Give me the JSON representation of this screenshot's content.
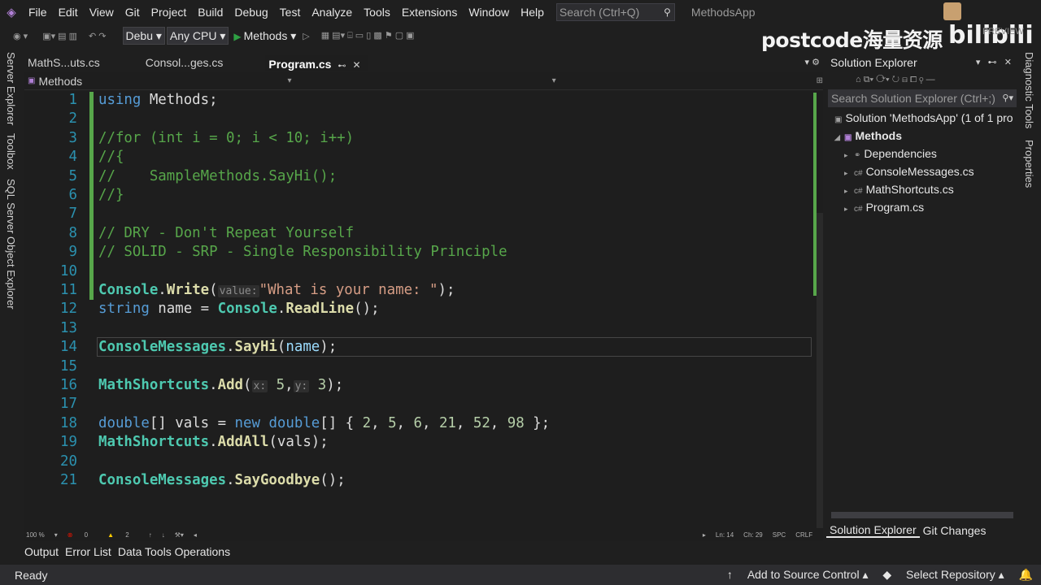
{
  "menu": {
    "items": [
      "File",
      "Edit",
      "View",
      "Git",
      "Project",
      "Build",
      "Debug",
      "Test",
      "Analyze",
      "Tools",
      "Extensions",
      "Window",
      "Help"
    ],
    "search_placeholder": "Search (Ctrl+Q)",
    "app_title": "MethodsApp"
  },
  "watermark": {
    "text": "postcode海量资源",
    "brand": "bilibili",
    "preview": "PREVIEW"
  },
  "toolbar": {
    "config": "Debu",
    "platform": "Any CPU",
    "run_label": "Methods"
  },
  "left_rail": [
    "Server Explorer",
    "Toolbox",
    "SQL Server Object Explorer"
  ],
  "right_rail": [
    "Diagnostic Tools",
    "Properties"
  ],
  "tabs": [
    {
      "label": "MathS...uts.cs"
    },
    {
      "label": "Consol...ges.cs"
    },
    {
      "label": "Program.cs",
      "active": true
    }
  ],
  "navbar": {
    "scope": "Methods"
  },
  "editor": {
    "current_line": 14,
    "lines": [
      {
        "n": "1",
        "tokens": [
          [
            "kw",
            "using"
          ],
          [
            "plain",
            " Methods;"
          ]
        ]
      },
      {
        "n": "2",
        "tokens": []
      },
      {
        "n": "3",
        "tokens": [
          [
            "cm",
            "//for (int i = 0; i < 10; i++)"
          ]
        ]
      },
      {
        "n": "4",
        "tokens": [
          [
            "cm",
            "//{"
          ]
        ]
      },
      {
        "n": "5",
        "tokens": [
          [
            "cm",
            "//    SampleMethods.SayHi();"
          ]
        ]
      },
      {
        "n": "6",
        "tokens": [
          [
            "cm",
            "//}"
          ]
        ]
      },
      {
        "n": "7",
        "tokens": []
      },
      {
        "n": "8",
        "tokens": [
          [
            "cm",
            "// DRY - Don't Repeat Yourself"
          ]
        ]
      },
      {
        "n": "9",
        "tokens": [
          [
            "cm",
            "// SOLID - SRP - Single Responsibility Principle"
          ]
        ]
      },
      {
        "n": "10",
        "tokens": []
      },
      {
        "n": "11",
        "tokens": [
          [
            "cls",
            "Console"
          ],
          [
            "plain",
            "."
          ],
          [
            "mth",
            "Write"
          ],
          [
            "plain",
            "("
          ],
          [
            "hint",
            "value:"
          ],
          [
            "str",
            "\"What is your name: \""
          ],
          [
            "plain",
            ");"
          ]
        ]
      },
      {
        "n": "12",
        "tokens": [
          [
            "kw",
            "string"
          ],
          [
            "plain",
            " name = "
          ],
          [
            "cls",
            "Console"
          ],
          [
            "plain",
            "."
          ],
          [
            "mth",
            "ReadLine"
          ],
          [
            "plain",
            "();"
          ]
        ]
      },
      {
        "n": "13",
        "tokens": []
      },
      {
        "n": "14",
        "tokens": [
          [
            "cls",
            "ConsoleMessages"
          ],
          [
            "plain",
            "."
          ],
          [
            "mth",
            "SayHi"
          ],
          [
            "plain",
            "("
          ],
          [
            "var",
            "name"
          ],
          [
            "plain",
            ");"
          ]
        ]
      },
      {
        "n": "15",
        "tokens": []
      },
      {
        "n": "16",
        "tokens": [
          [
            "cls",
            "MathShortcuts"
          ],
          [
            "plain",
            "."
          ],
          [
            "mth",
            "Add"
          ],
          [
            "plain",
            "("
          ],
          [
            "hint",
            "x:"
          ],
          [
            "num",
            " 5"
          ],
          [
            "plain",
            ","
          ],
          [
            "hint",
            "y:"
          ],
          [
            "num",
            " 3"
          ],
          [
            "plain",
            ");"
          ]
        ]
      },
      {
        "n": "17",
        "tokens": []
      },
      {
        "n": "18",
        "tokens": [
          [
            "kw",
            "double"
          ],
          [
            "plain",
            "[] vals = "
          ],
          [
            "kw",
            "new"
          ],
          [
            "plain",
            " "
          ],
          [
            "kw",
            "double"
          ],
          [
            "plain",
            "[] { "
          ],
          [
            "num",
            "2"
          ],
          [
            "plain",
            ", "
          ],
          [
            "num",
            "5"
          ],
          [
            "plain",
            ", "
          ],
          [
            "num",
            "6"
          ],
          [
            "plain",
            ", "
          ],
          [
            "num",
            "21"
          ],
          [
            "plain",
            ", "
          ],
          [
            "num",
            "52"
          ],
          [
            "plain",
            ", "
          ],
          [
            "num",
            "98"
          ],
          [
            "plain",
            " };"
          ]
        ]
      },
      {
        "n": "19",
        "tokens": [
          [
            "cls",
            "MathShortcuts"
          ],
          [
            "plain",
            "."
          ],
          [
            "mth",
            "AddAll"
          ],
          [
            "plain",
            "(vals);"
          ]
        ]
      },
      {
        "n": "20",
        "tokens": []
      },
      {
        "n": "21",
        "tokens": [
          [
            "cls",
            "ConsoleMessages"
          ],
          [
            "plain",
            "."
          ],
          [
            "mth",
            "SayGoodbye"
          ],
          [
            "plain",
            "();"
          ]
        ]
      }
    ]
  },
  "editor_status": {
    "zoom": "100 %",
    "errors": "0",
    "warnings": "2",
    "line": "Ln: 14",
    "col": "Ch: 29",
    "spc": "SPC",
    "eol": "CRLF"
  },
  "bottom_tabs": [
    "Output",
    "Error List",
    "Data Tools Operations"
  ],
  "solution": {
    "title": "Solution Explorer",
    "search_placeholder": "Search Solution Explorer (Ctrl+;)",
    "root": "Solution 'MethodsApp' (1 of 1 pro",
    "project": "Methods",
    "items": [
      "Dependencies",
      "ConsoleMessages.cs",
      "MathShortcuts.cs",
      "Program.cs"
    ],
    "tabs": [
      "Solution Explorer",
      "Git Changes"
    ]
  },
  "statusbar": {
    "ready": "Ready",
    "source_control": "Add to Source Control",
    "repository": "Select Repository"
  },
  "colors": {
    "keyword": "#569cd6",
    "comment": "#57a64a",
    "class": "#4ec9b0",
    "method": "#dcdcaa",
    "string": "#d69d85",
    "number": "#b5cea8"
  }
}
